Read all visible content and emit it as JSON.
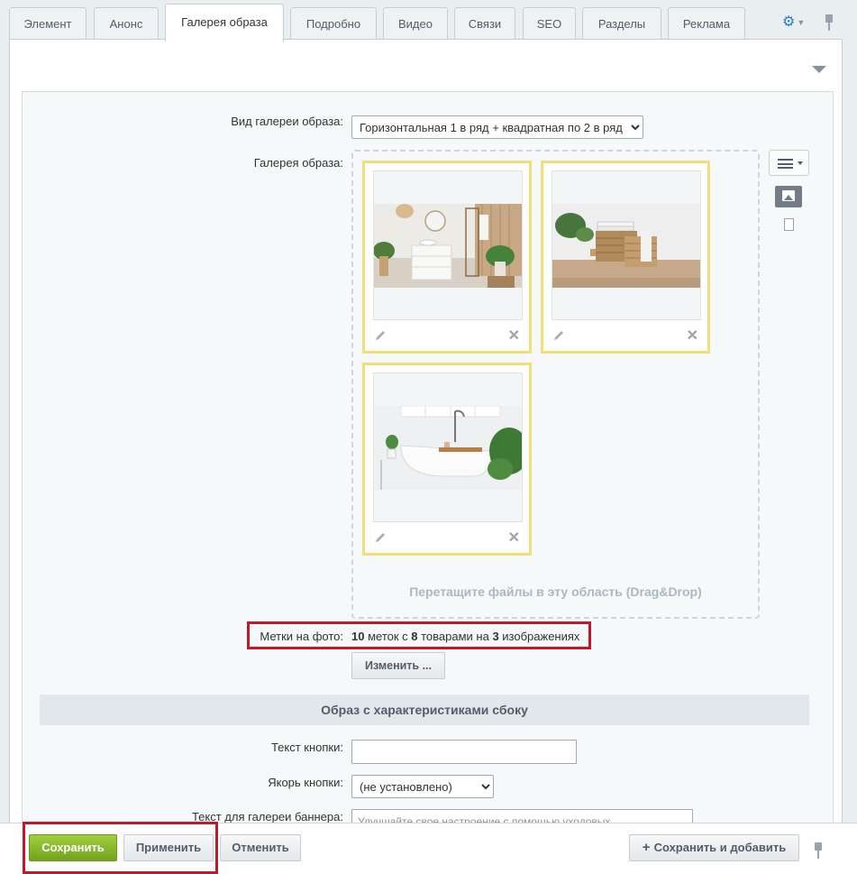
{
  "tabs": [
    {
      "label": "Элемент",
      "active": false
    },
    {
      "label": "Анонс",
      "active": false
    },
    {
      "label": "Галерея образа",
      "active": true
    },
    {
      "label": "Подробно",
      "active": false
    },
    {
      "label": "Видео",
      "active": false
    },
    {
      "label": "Связи",
      "active": false
    },
    {
      "label": "SEO",
      "active": false
    },
    {
      "label": "Разделы",
      "active": false
    },
    {
      "label": "Реклама",
      "active": false
    }
  ],
  "gallery_view": {
    "label": "Вид галереи образа:",
    "selected": "Горизонтальная 1 в ряд + квадратная по 2 в ряд"
  },
  "gallery": {
    "label": "Галерея образа:",
    "drop_hint": "Перетащите файлы в эту область (Drag&Drop)",
    "images": [
      {
        "name": "bathroom-shelves-photo"
      },
      {
        "name": "laundry-baskets-photo"
      },
      {
        "name": "bathtub-plants-photo"
      }
    ]
  },
  "photo_tags": {
    "label": "Метки на фото:",
    "count_tags": "10",
    "text_tags": " меток с ",
    "count_products": "8",
    "text_products": " товарами на ",
    "count_images": "3",
    "text_images": " изображениях",
    "edit_button": "Изменить ..."
  },
  "section": {
    "title": "Образ с характеристиками сбоку"
  },
  "fields": {
    "button_text_label": "Текст кнопки:",
    "button_text_value": "",
    "button_anchor_label": "Якорь кнопки:",
    "button_anchor_selected": "(не установлено)",
    "banner_text_label": "Текст для галереи баннера:",
    "banner_text_value": "Улучшайте свое настроение с помощью уходовых"
  },
  "footer": {
    "save": "Сохранить",
    "apply": "Применить",
    "cancel": "Отменить",
    "save_add": "Сохранить и добавить"
  },
  "colors": {
    "accent": "#2380c6",
    "highlight_frame": "#c0192a",
    "card_border": "#f2df79",
    "save_green": "#86b92b"
  }
}
